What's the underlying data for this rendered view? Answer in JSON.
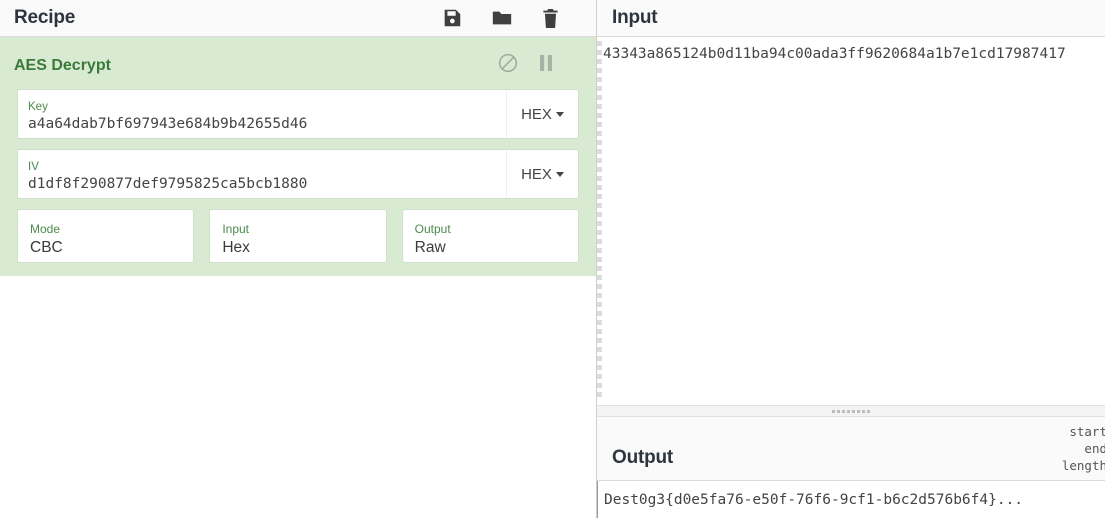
{
  "recipe": {
    "title": "Recipe",
    "title_icons": [
      {
        "name": "save-icon",
        "label": "Save recipe"
      },
      {
        "name": "folder-icon",
        "label": "Load recipe"
      },
      {
        "name": "trash-icon",
        "label": "Clear recipe"
      }
    ],
    "operation": {
      "name": "AES Decrypt",
      "disable_icon_label": "Disable operation",
      "breakpoint_icon_label": "Set breakpoint",
      "args": [
        {
          "label": "Key",
          "value": "a4a64dab7bf697943e684b9b42655d46",
          "unit": "HEX"
        },
        {
          "label": "IV",
          "value": "d1df8f290877def9795825ca5bcb1880",
          "unit": "HEX"
        }
      ],
      "selects": [
        {
          "label": "Mode",
          "value": "CBC"
        },
        {
          "label": "Input",
          "value": "Hex"
        },
        {
          "label": "Output",
          "value": "Raw"
        }
      ]
    }
  },
  "input": {
    "title": "Input",
    "value": "43343a865124b0d11ba94c00ada3ff9620684a1b7e1cd17987417"
  },
  "output": {
    "title": "Output",
    "value": "Dest0g3{d0e5fa76-e50f-76f6-9cf1-b6c2d576b6f4}...",
    "info": {
      "start": "start",
      "end": "end",
      "length": "length"
    }
  },
  "colors": {
    "operation_bg": "#d9ead3",
    "operation_text": "#3a7a3a",
    "arg_label": "#4a8a4a",
    "header_bg": "#fafafa",
    "title_text": "#2e3440"
  }
}
